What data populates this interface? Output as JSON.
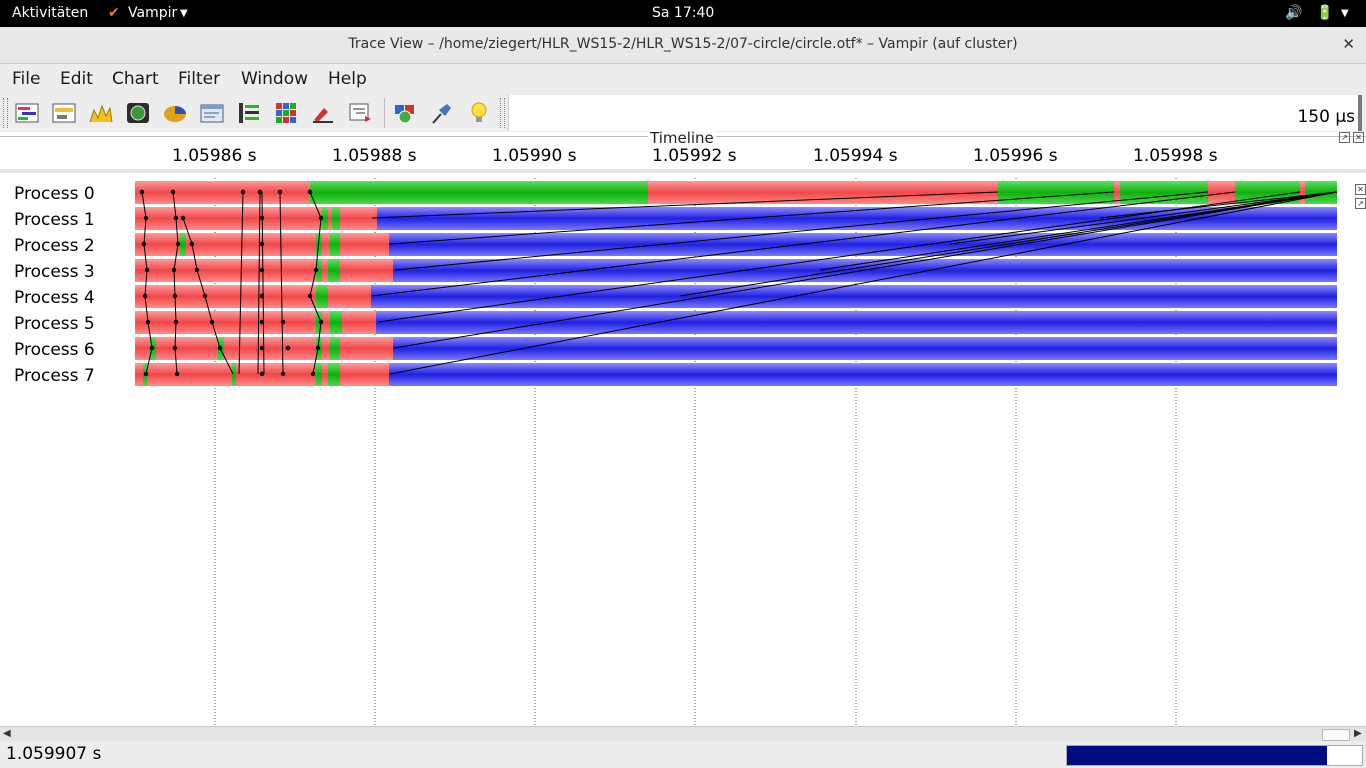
{
  "system_bar": {
    "activities": "Aktivitäten",
    "app_name": "Vampir",
    "clock": "Sa 17:40"
  },
  "window": {
    "title": "Trace View – /home/ziegert/HLR_WS15-2/HLR_WS15-2/07-circle/circle.otf* – Vampir (auf cluster)",
    "close_glyph": "✕"
  },
  "menu": [
    "File",
    "Edit",
    "Chart",
    "Filter",
    "Window",
    "Help"
  ],
  "toolbar": {
    "icons": [
      "master-timeline-icon",
      "process-timeline-icon",
      "counter-timeline-icon",
      "performance-radar-icon",
      "function-summary-icon",
      "context-view-icon",
      "message-summary-icon",
      "communication-matrix-icon",
      "io-summary-icon",
      "call-tree-icon",
      "filter-icon",
      "pin-icon",
      "lightbulb-icon"
    ],
    "zoom_value": "150 µs"
  },
  "timeline": {
    "label": "Timeline",
    "ticks": [
      "1.05986 s",
      "1.05988 s",
      "1.05990 s",
      "1.05992 s",
      "1.05994 s",
      "1.05996 s",
      "1.05998 s"
    ],
    "processes": [
      "Process 0",
      "Process 1",
      "Process 2",
      "Process 3",
      "Process 4",
      "Process 5",
      "Process 6",
      "Process 7"
    ],
    "colors": {
      "mpi": "#ff3a3a",
      "application": "#12c012",
      "idle_blue": "#2a2ae8",
      "messages": "#000000"
    }
  },
  "status": {
    "cursor_time": "1.059907 s",
    "progress": 0.88
  }
}
